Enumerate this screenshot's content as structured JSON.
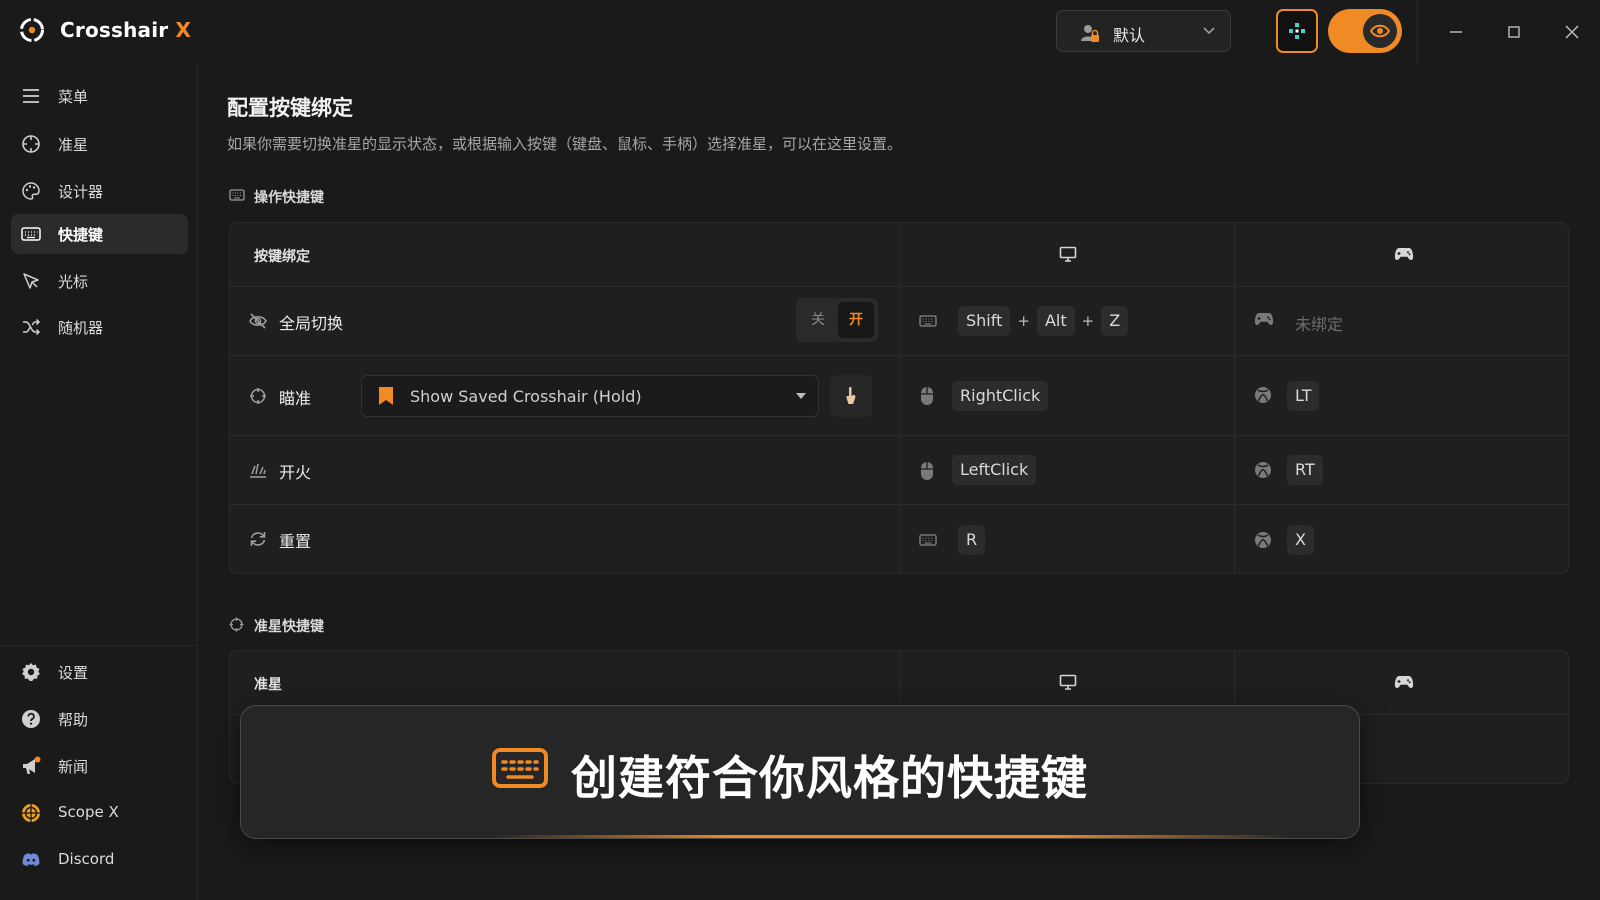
{
  "app": {
    "name": "Crosshair",
    "name_suffix": "X"
  },
  "profile": {
    "name": "默认"
  },
  "sidebar": {
    "items": [
      {
        "label": "菜单",
        "icon": "menu-icon"
      },
      {
        "label": "准星",
        "icon": "crosshair-icon"
      },
      {
        "label": "设计器",
        "icon": "palette-icon"
      },
      {
        "label": "快捷键",
        "icon": "keyboard-icon",
        "active": true
      },
      {
        "label": "光标",
        "icon": "cursor-icon"
      },
      {
        "label": "随机器",
        "icon": "shuffle-icon"
      }
    ],
    "bottom_items": [
      {
        "label": "设置",
        "icon": "gear-icon"
      },
      {
        "label": "帮助",
        "icon": "help-icon"
      },
      {
        "label": "新闻",
        "icon": "megaphone-icon"
      },
      {
        "label": "Scope X",
        "icon": "scope-icon"
      },
      {
        "label": "Discord",
        "icon": "discord-icon"
      }
    ]
  },
  "page": {
    "title": "配置按键绑定",
    "description": "如果你需要切换准星的显示状态，或根据输入按键（键盘、鼠标、手柄）选择准星，可以在这里设置。"
  },
  "section_actions": {
    "heading": "操作快捷键",
    "table_header": "按键绑定",
    "rows": [
      {
        "label": "全局切换",
        "icon": "eye-off-icon",
        "toggle_off": "关",
        "toggle_on": "开",
        "toggle_state": "on",
        "pc_keys": [
          "Shift",
          "Alt",
          "Z"
        ],
        "pad_unbound": "未绑定"
      },
      {
        "label": "瞄准",
        "icon": "crosshair-icon",
        "dropdown_value": "Show Saved Crosshair (Hold)",
        "pc_keys": [
          "RightClick"
        ],
        "pad_keys": [
          "LT"
        ]
      },
      {
        "label": "开火",
        "icon": "fire-icon",
        "pc_keys": [
          "LeftClick"
        ],
        "pad_keys": [
          "RT"
        ]
      },
      {
        "label": "重置",
        "icon": "refresh-icon",
        "pc_keys": [
          "R"
        ],
        "pad_keys": [
          "X"
        ]
      }
    ]
  },
  "section_crosshair": {
    "heading": "准星快捷键",
    "table_header": "准星"
  },
  "banner": {
    "text": "创建符合你风格的快捷键"
  },
  "colors": {
    "accent": "#f08a24",
    "background": "#1a1a1a",
    "panel": "#1f1f1f"
  }
}
